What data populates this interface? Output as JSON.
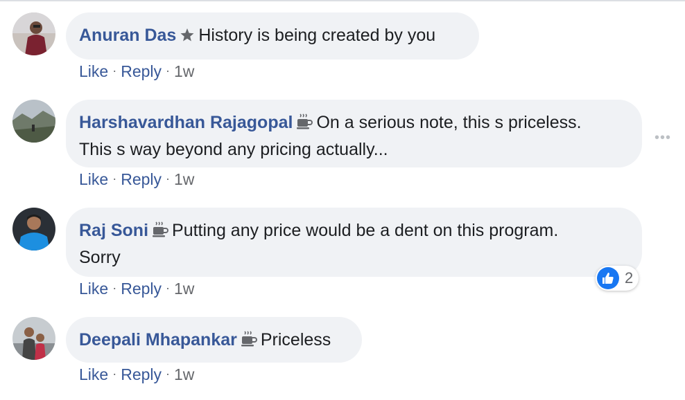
{
  "comments": [
    {
      "author": "Anuran Das",
      "badge_icon": "star-badge-icon",
      "text": "History is being created by you",
      "actions": {
        "like": "Like",
        "reply": "Reply",
        "time": "1w"
      }
    },
    {
      "author": "Harshavardhan Rajagopal",
      "badge_icon": "coffee-cup-icon",
      "text_line1": "On a serious note, this s priceless.",
      "text_line2": "This s way beyond any pricing actually...",
      "actions": {
        "like": "Like",
        "reply": "Reply",
        "time": "1w"
      },
      "more_menu_icon": "more-options-icon"
    },
    {
      "author": "Raj Soni",
      "badge_icon": "coffee-cup-icon",
      "text_line1": "Putting any price would be a dent on this program.",
      "text_line2": "Sorry",
      "actions": {
        "like": "Like",
        "reply": "Reply",
        "time": "1w"
      },
      "reactions": {
        "icon": "like-reaction-icon",
        "count": "2"
      }
    },
    {
      "author": "Deepali Mhapankar",
      "badge_icon": "coffee-cup-icon",
      "text": "Priceless",
      "actions": {
        "like": "Like",
        "reply": "Reply",
        "time": "1w"
      }
    }
  ],
  "colors": {
    "author_link": "#385898",
    "bubble_bg": "#f0f2f5",
    "meta_gray": "#65676b",
    "like_blue": "#1877f2"
  }
}
